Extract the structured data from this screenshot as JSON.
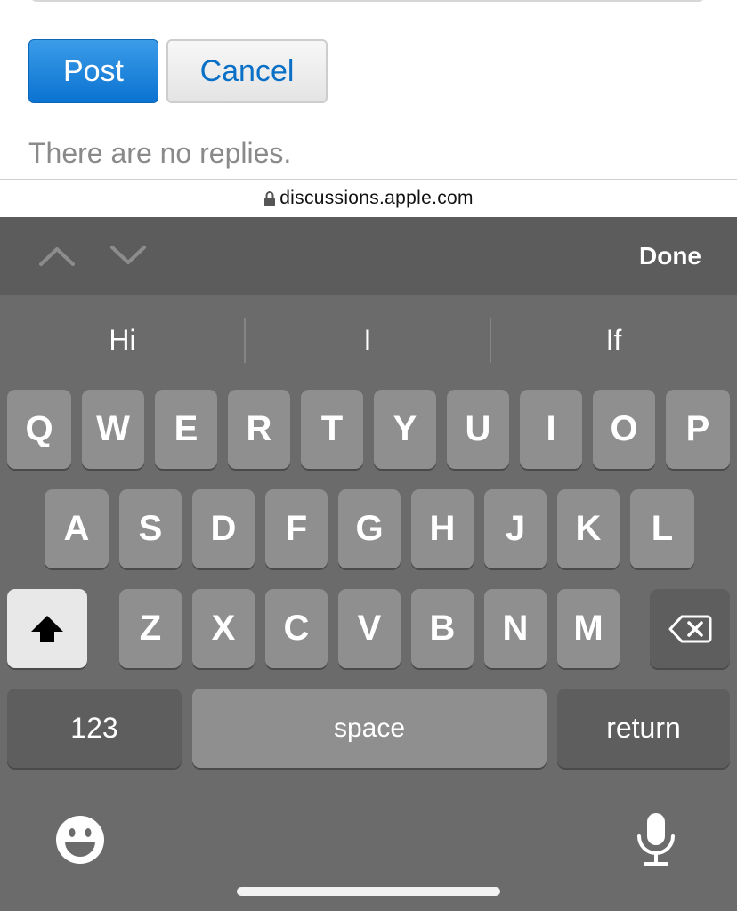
{
  "web": {
    "post_label": "Post",
    "cancel_label": "Cancel",
    "no_replies_text": "There are no replies."
  },
  "browser": {
    "url": "discussions.apple.com"
  },
  "keyboard": {
    "done_label": "Done",
    "suggestions": [
      "Hi",
      "I",
      "If"
    ],
    "row1": [
      "Q",
      "W",
      "E",
      "R",
      "T",
      "Y",
      "U",
      "I",
      "O",
      "P"
    ],
    "row2": [
      "A",
      "S",
      "D",
      "F",
      "G",
      "H",
      "J",
      "K",
      "L"
    ],
    "row3": [
      "Z",
      "X",
      "C",
      "V",
      "B",
      "N",
      "M"
    ],
    "numbers_label": "123",
    "space_label": "space",
    "return_label": "return",
    "icons": {
      "prev": "chevron-up-icon",
      "next": "chevron-down-icon",
      "shift": "shift-icon",
      "delete": "delete-icon",
      "emoji": "emoji-icon",
      "mic": "microphone-icon"
    }
  },
  "colors": {
    "accent": "#0a72d1",
    "keyboard_bg": "#6b6b6b",
    "key_bg": "#8f8f8f"
  }
}
